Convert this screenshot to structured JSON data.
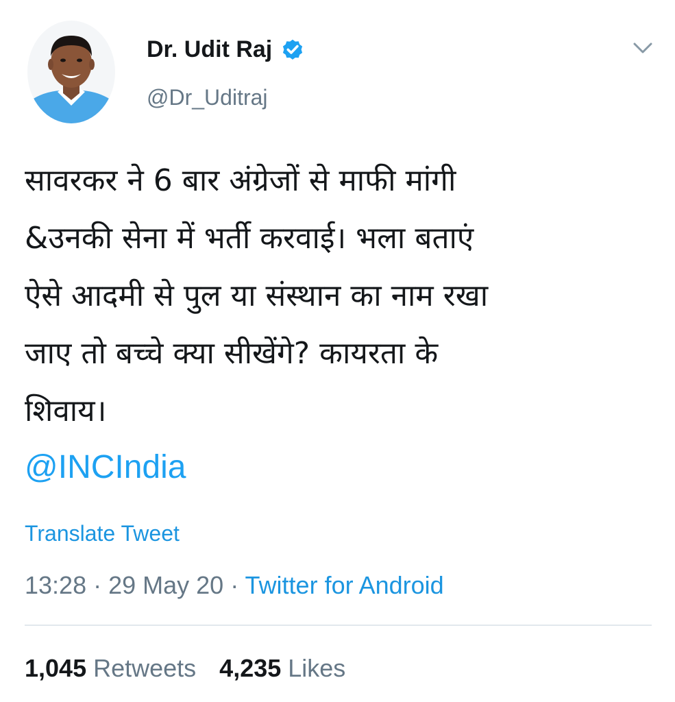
{
  "author": {
    "display_name": "Dr. Udit Raj",
    "handle": "@Dr_Uditraj",
    "verified_icon": "verified-badge-icon",
    "avatar_icon": "profile-photo"
  },
  "menu": {
    "icon": "chevron-down-icon"
  },
  "tweet": {
    "text": "सावरकर ने 6 बार अंग्रेजों से माफी मांगी\n&उनकी सेना में भर्ती करवाई। भला बताएं\nऐसे आदमी से पुल या संस्थान का नाम रखा\nजाए तो बच्चे क्या सीखेंगे? कायरता के\nशिवाय।",
    "mention": "@INCIndia",
    "translate_label": "Translate Tweet"
  },
  "meta": {
    "time": "13:28",
    "separator": " · ",
    "date": "29 May 20",
    "source": "Twitter for Android"
  },
  "stats": {
    "retweets_count": "1,045",
    "retweets_label": "Retweets",
    "likes_count": "4,235",
    "likes_label": "Likes"
  },
  "colors": {
    "link": "#1da1f2",
    "secondary_text": "#657786",
    "primary_text": "#14171a",
    "divider": "#e1e8ed"
  }
}
